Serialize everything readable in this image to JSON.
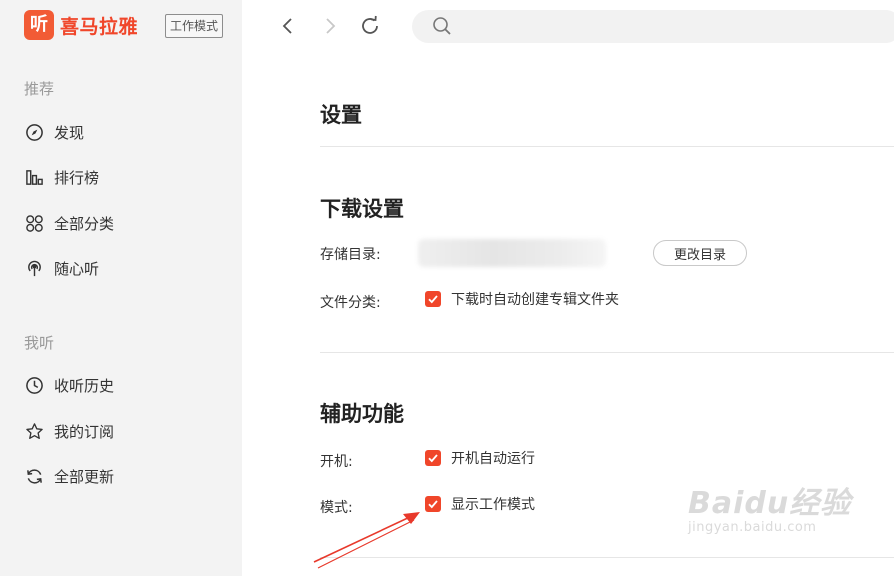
{
  "app": {
    "logo_glyph": "听",
    "logo_text": "喜马拉雅",
    "work_mode_badge": "工作模式",
    "brand_color": "#f0462a"
  },
  "sidebar": {
    "section_recommend": "推荐",
    "recommend_items": [
      {
        "label": "发现",
        "icon": "compass-icon"
      },
      {
        "label": "排行榜",
        "icon": "bar-chart-icon"
      },
      {
        "label": "全部分类",
        "icon": "grid-icon"
      },
      {
        "label": "随心听",
        "icon": "radio-icon"
      }
    ],
    "section_mine": "我听",
    "mine_items": [
      {
        "label": "收听历史",
        "icon": "clock-icon"
      },
      {
        "label": "我的订阅",
        "icon": "star-icon"
      },
      {
        "label": "全部更新",
        "icon": "refresh-icon"
      }
    ]
  },
  "toolbar": {
    "back_icon": "chevron-left-icon",
    "forward_icon": "chevron-right-icon",
    "refresh_icon": "refresh-icon",
    "search_icon": "search-icon",
    "search_placeholder": ""
  },
  "main": {
    "title": "设置",
    "download": {
      "heading": "下载设置",
      "storage_label": "存储目录:",
      "change_dir_button": "更改目录",
      "classify_label": "文件分类:",
      "classify_option": "下载时自动创建专辑文件夹",
      "classify_checked": true
    },
    "assist": {
      "heading": "辅助功能",
      "boot_label": "开机:",
      "boot_option": "开机自动运行",
      "boot_checked": true,
      "mode_label": "模式:",
      "mode_option": "显示工作模式",
      "mode_checked": true
    }
  },
  "watermark": {
    "brand": "Baidu经验",
    "url": "jingyan.baidu.com"
  }
}
